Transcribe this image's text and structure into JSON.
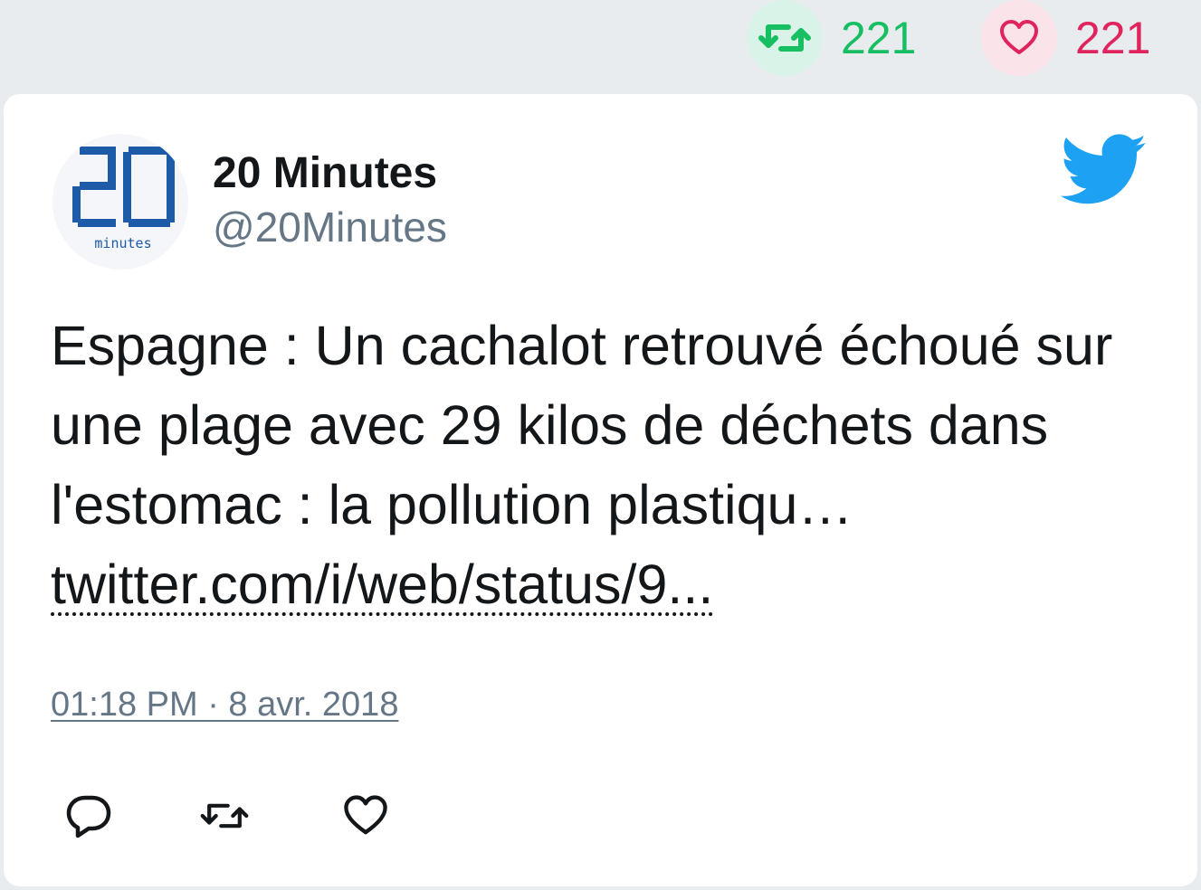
{
  "top_stats": {
    "retweets": "221",
    "likes": "221"
  },
  "author": {
    "name": "20 Minutes",
    "handle": "@20Minutes",
    "avatar_icon": "20-minutes-logo-icon",
    "avatar_logo_digits": "20",
    "avatar_logo_word": "minutes"
  },
  "tweet": {
    "text": "Espagne : Un cachalot retrouvé échoué sur une plage avec 29 kilos de déchets dans l'estomac : la pollution plastiqu… ",
    "link": "twitter.com/i/web/status/9...",
    "timestamp": "01:18 PM · 8 avr. 2018"
  },
  "icons": {
    "brand": "twitter-bird-icon",
    "reply": "reply-icon",
    "retweet": "retweet-icon",
    "like": "heart-icon"
  },
  "colors": {
    "retweet_green": "#17bf63",
    "like_red": "#e0245e",
    "twitter_blue": "#1da1f2",
    "logo_blue": "#1d5aa8",
    "muted_gray": "#657786",
    "text": "#14171a"
  }
}
